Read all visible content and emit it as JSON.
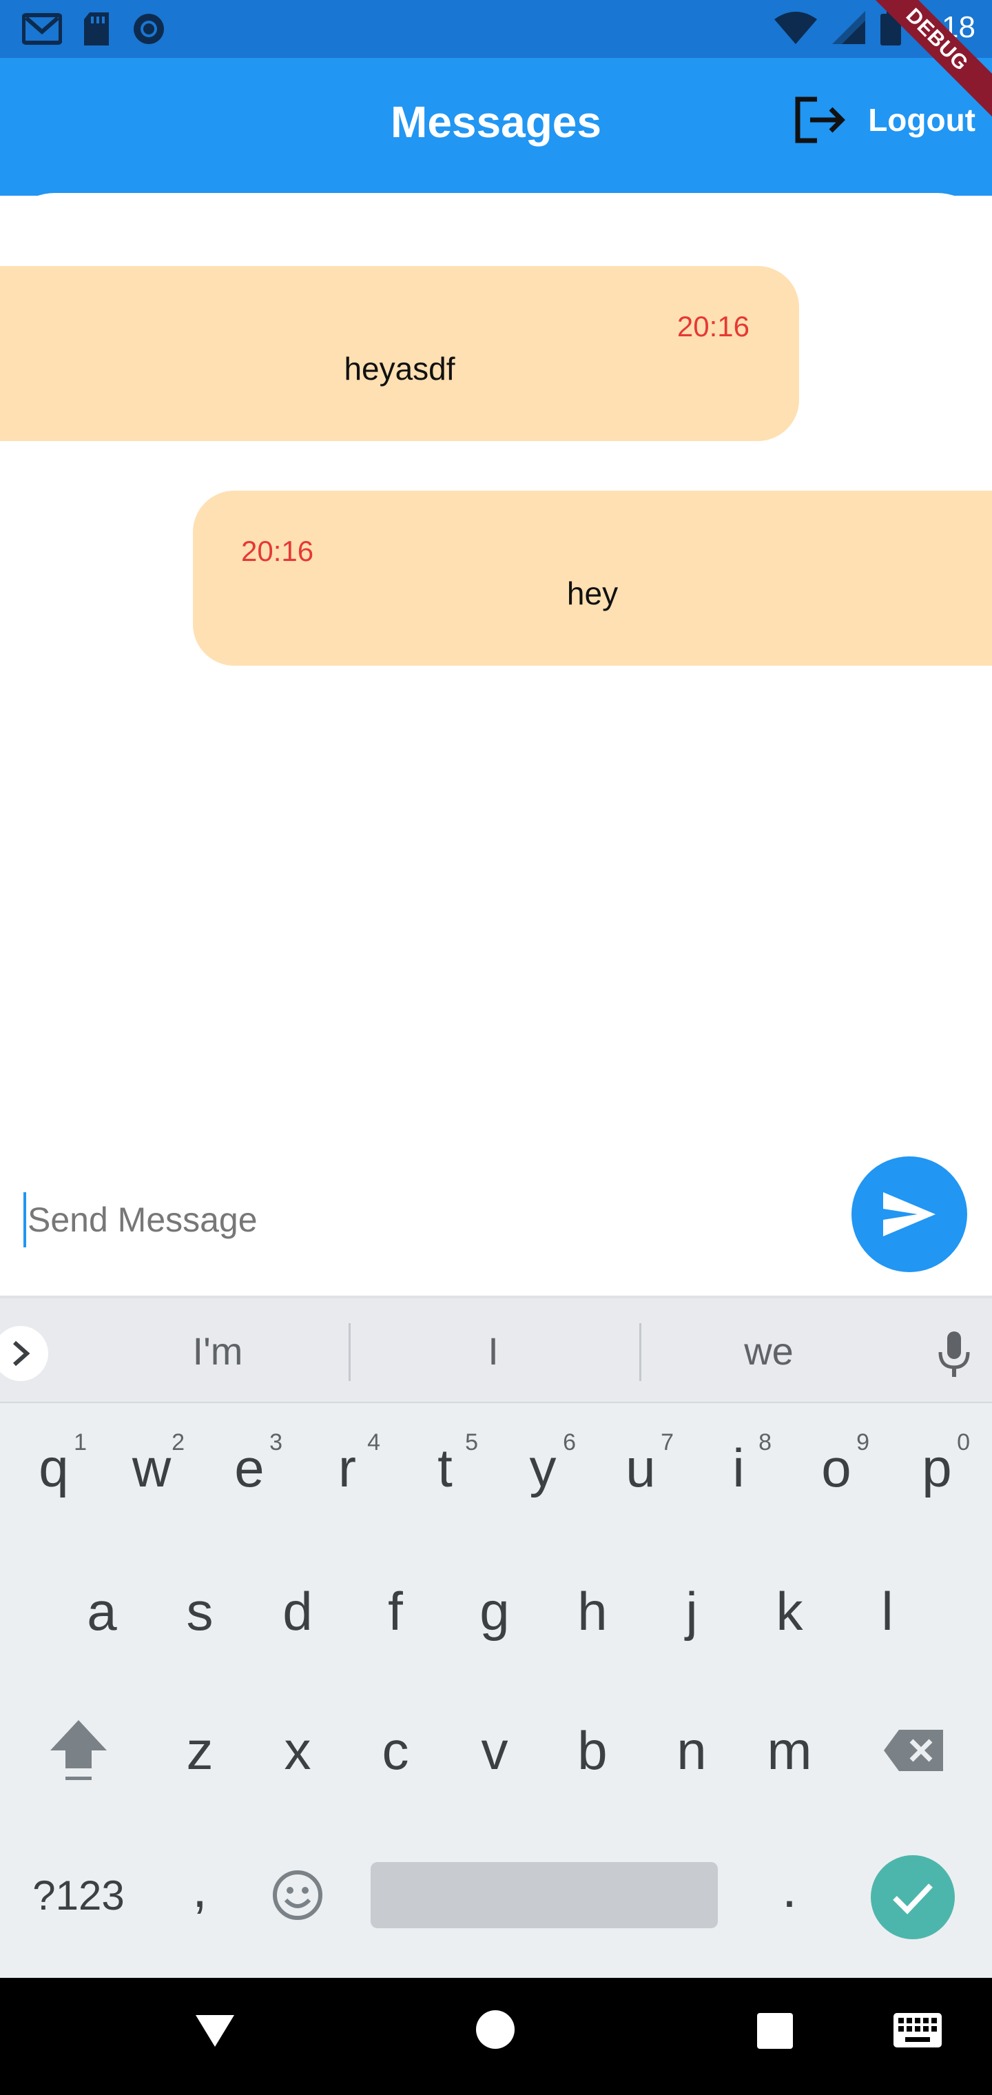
{
  "status_bar": {
    "time": "8:18",
    "left_icons": [
      "gmail-icon",
      "sd-card-icon",
      "sync-icon"
    ],
    "right_icons": [
      "wifi-icon",
      "cell-signal-icon",
      "battery-icon"
    ]
  },
  "debug_ribbon": {
    "label": "DEBUG"
  },
  "app_bar": {
    "title": "Messages",
    "logout_label": "Logout",
    "background": "#2196f3"
  },
  "messages": [
    {
      "side": "left",
      "time": "20:16",
      "text": "heyasdf",
      "bubble_color": "#ffe0b2"
    },
    {
      "side": "right",
      "time": "20:16",
      "text": "hey",
      "bubble_color": "#ffe0b2"
    }
  ],
  "composer": {
    "placeholder": "Send Message",
    "value": "",
    "send_icon": "send-icon"
  },
  "keyboard": {
    "suggestions": [
      "I'm",
      "I",
      "we"
    ],
    "row1": [
      {
        "key": "q",
        "hint": "1"
      },
      {
        "key": "w",
        "hint": "2"
      },
      {
        "key": "e",
        "hint": "3"
      },
      {
        "key": "r",
        "hint": "4"
      },
      {
        "key": "t",
        "hint": "5"
      },
      {
        "key": "y",
        "hint": "6"
      },
      {
        "key": "u",
        "hint": "7"
      },
      {
        "key": "i",
        "hint": "8"
      },
      {
        "key": "o",
        "hint": "9"
      },
      {
        "key": "p",
        "hint": "0"
      }
    ],
    "row2": [
      "a",
      "s",
      "d",
      "f",
      "g",
      "h",
      "j",
      "k",
      "l"
    ],
    "row3": [
      "z",
      "x",
      "c",
      "v",
      "b",
      "n",
      "m"
    ],
    "row4": {
      "symbols": "?123",
      "comma": ",",
      "period": "."
    }
  },
  "nav_bar": {
    "buttons": [
      "back-icon",
      "home-icon",
      "recents-icon",
      "keyboard-icon"
    ]
  }
}
